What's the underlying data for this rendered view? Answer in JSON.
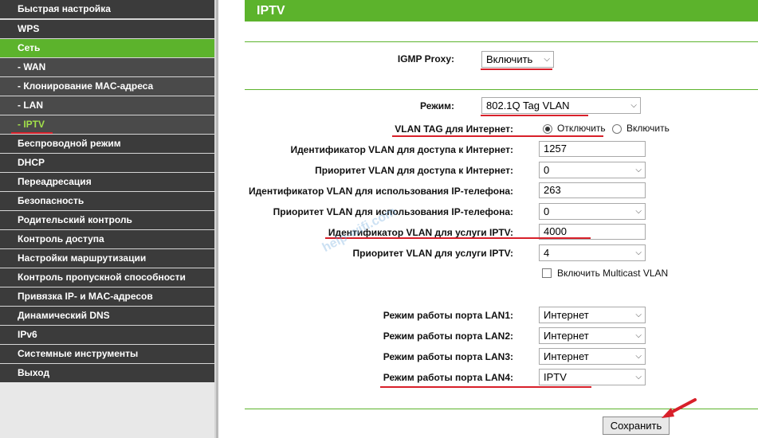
{
  "sidebar": {
    "items": [
      {
        "label": "Быстрая настройка"
      },
      {
        "label": "WPS"
      },
      {
        "label": "Сеть"
      },
      {
        "label": "- WAN"
      },
      {
        "label": "- Клонирование MAC-адреса"
      },
      {
        "label": "- LAN"
      },
      {
        "label": "- IPTV"
      },
      {
        "label": "Беспроводной режим"
      },
      {
        "label": "DHCP"
      },
      {
        "label": "Переадресация"
      },
      {
        "label": "Безопасность"
      },
      {
        "label": "Родительский контроль"
      },
      {
        "label": "Контроль доступа"
      },
      {
        "label": "Настройки маршрутизации"
      },
      {
        "label": "Контроль пропускной способности"
      },
      {
        "label": "Привязка IP- и MAC-адресов"
      },
      {
        "label": "Динамический DNS"
      },
      {
        "label": "IPv6"
      },
      {
        "label": "Системные инструменты"
      },
      {
        "label": "Выход"
      }
    ]
  },
  "page": {
    "title": "IPTV"
  },
  "igmp": {
    "label": "IGMP Proxy:",
    "value": "Включить"
  },
  "mode": {
    "label": "Режим:",
    "value": "802.1Q Tag VLAN"
  },
  "vlan_tag": {
    "label": "VLAN TAG для Интернет:",
    "opt_off": "Отключить",
    "opt_on": "Включить"
  },
  "fields": {
    "inet_vlan_id": {
      "label": "Идентификатор VLAN для доступа к Интернет:",
      "value": "1257"
    },
    "inet_vlan_prio": {
      "label": "Приоритет VLAN для доступа к Интернет:",
      "value": "0"
    },
    "ipphone_vlan_id": {
      "label": "Идентификатор VLAN для использования IP-телефона:",
      "value": "263"
    },
    "ipphone_vlan_prio": {
      "label": "Приоритет VLAN для использования IP-телефона:",
      "value": "0"
    },
    "iptv_vlan_id": {
      "label": "Идентификатор VLAN для услуги IPTV:",
      "value": "4000"
    },
    "iptv_vlan_prio": {
      "label": "Приоритет VLAN для услуги IPTV:",
      "value": "4"
    }
  },
  "multicast": {
    "label": "Включить Multicast VLAN"
  },
  "lan_ports": [
    {
      "label": "Режим работы порта LAN1:",
      "value": "Интернет"
    },
    {
      "label": "Режим работы порта LAN2:",
      "value": "Интернет"
    },
    {
      "label": "Режим работы порта LAN3:",
      "value": "Интернет"
    },
    {
      "label": "Режим работы порта LAN4:",
      "value": "IPTV"
    }
  ],
  "actions": {
    "save_label": "Сохранить"
  },
  "watermark": "help-wifi.com",
  "colors": {
    "accent": "#5cb32c",
    "sidebar": "#3b3b3b",
    "highlight": "#d8202a"
  }
}
